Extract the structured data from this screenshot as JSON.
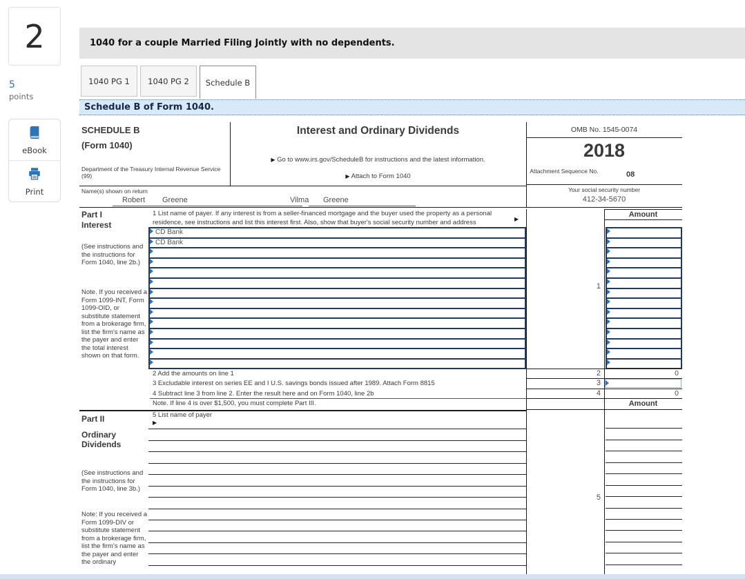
{
  "colors": {
    "accent": "#2e74b5",
    "input_border": "#1f3864",
    "highlight_bg": "#d8e9f9",
    "banner_bg": "#e4e4e4"
  },
  "sidebar": {
    "question_number": "2",
    "points_value": "5",
    "points_label": "points",
    "ebook_label": "eBook",
    "print_label": "Print"
  },
  "banner": {
    "text": "1040 for a couple Married Filing Jointly with no dependents."
  },
  "tabs": [
    {
      "label": "1040 PG 1",
      "active": false
    },
    {
      "label": "1040 PG 2",
      "active": false
    },
    {
      "label": "Schedule B",
      "active": true
    }
  ],
  "subtitle": "Schedule B of Form 1040.",
  "form": {
    "schedule": "SCHEDULE B",
    "form_number": "(Form 1040)",
    "department": "Department of the Treasury Internal Revenue Service (99)",
    "title": "Interest and Ordinary Dividends",
    "goto_line": "Go to www.irs.gov/ScheduleB for instructions and the latest information.",
    "attach_line": "Attach to Form 1040",
    "pointer_glyph": "▶",
    "omb": "OMB No. 1545-0074",
    "year": "2018",
    "attachment_label": "Attachment Sequence No.",
    "attachment_value": "08",
    "name_label": "Name(s) shown on return",
    "names": [
      "Robert",
      "Greene",
      "Vilma",
      "Greene"
    ],
    "ssn_label": "Your social security number",
    "ssn": "412-34-5670",
    "part1": {
      "part_label": "Part I",
      "part_title": "Interest",
      "see_note": "(See instructions and the instructions for Form 1040, line 2b.)",
      "note": "Note.  If you received a Form 1099-INT, Form 1099-OID, or substitute statement from a brokerage firm, list the firm's name as the payer and enter the total interest shown on that form.",
      "line1_text": "1  List name of payer.  If any interest is from a seller-financed mortgage and the buyer used the property as a personal residence, see instructions and list this interest first.  Also, show that buyer's social security number and address",
      "amount_header": "Amount",
      "line1_number": "1",
      "payers": [
        "CD Bank",
        "CD Bank",
        "",
        "",
        "",
        "",
        "",
        "",
        "",
        "",
        "",
        "",
        "",
        ""
      ],
      "amounts": [
        "",
        "",
        "",
        "",
        "",
        "",
        "",
        "",
        "",
        "",
        "",
        "",
        "",
        ""
      ],
      "line2": {
        "num": "2",
        "text": "2  Add the amounts on line 1",
        "value": "0"
      },
      "line3": {
        "num": "3",
        "text": "3  Excludable interest on series EE and I U.S. savings bonds issued after 1989.  Attach Form 8815",
        "value": ""
      },
      "line4": {
        "num": "4",
        "text": "4  Subtract line 3 from line 2.  Enter the result here and on Form 1040, line 2b",
        "value": "0"
      },
      "note_line": "Note.  If line 4 is over $1,500, you must complete Part III."
    },
    "part2": {
      "part_label": "Part II",
      "part_title": "Ordinary Dividends",
      "see_note": "(See instructions and the instructions for Form 1040, line 3b.)",
      "note": "Note: If you received a Form 1099-DIV or substitute statement from a brokerage firm, list the firm's name as the payer and enter the ordinary",
      "line5_text": "5  List name of payer",
      "amount_header": "Amount",
      "line5_number": "5",
      "payer_row_count": 14,
      "amount_row_count": 14
    }
  }
}
